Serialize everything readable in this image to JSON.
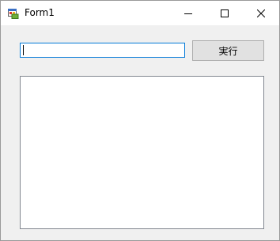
{
  "window": {
    "title": "Form1",
    "icon": "winforms-app-icon",
    "controls": {
      "minimize_icon": "minimize-icon",
      "maximize_icon": "maximize-icon",
      "close_icon": "close-icon"
    }
  },
  "form": {
    "input": {
      "value": "",
      "placeholder": ""
    },
    "run_button_label": "実行",
    "output_list": {
      "items": []
    }
  },
  "colors": {
    "window_bg": "#f0f0f0",
    "titlebar_bg": "#ffffff",
    "focus_border": "#0078d7",
    "button_bg": "#e1e1e1"
  }
}
